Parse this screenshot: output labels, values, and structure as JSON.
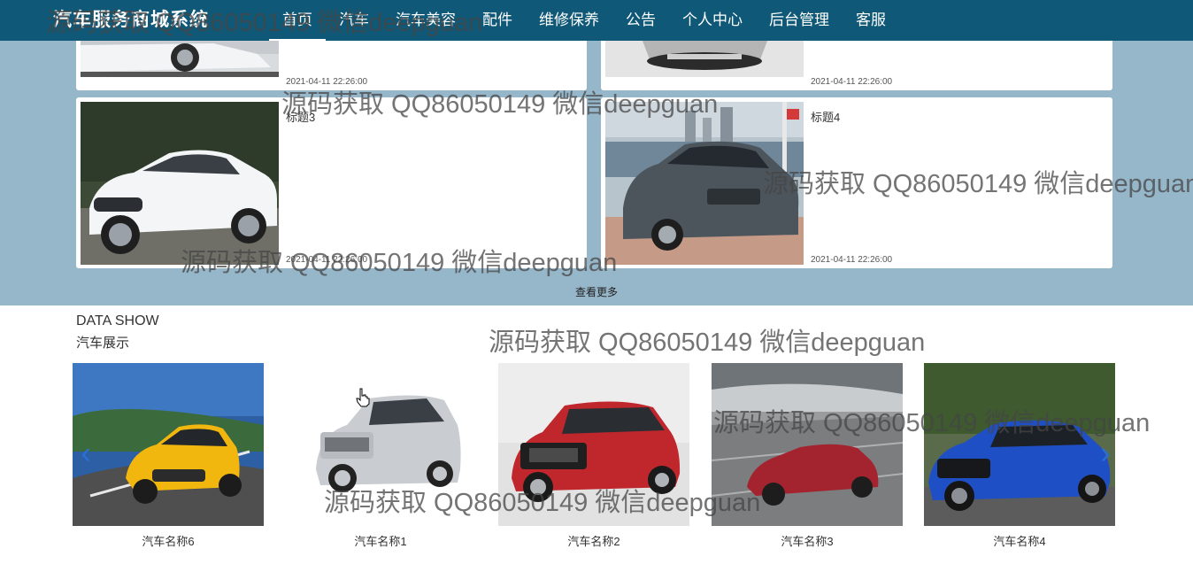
{
  "nav": {
    "brand": "汽车服务商城系统",
    "items": [
      "首页",
      "汽车",
      "汽车美容",
      "配件",
      "维修保养",
      "公告",
      "个人中心",
      "后台管理",
      "客服"
    ]
  },
  "news": {
    "items": [
      {
        "title": "",
        "date": "2021-04-11 22:26:00"
      },
      {
        "title": "",
        "date": "2021-04-11 22:26:00"
      },
      {
        "title": "标题3",
        "date": "2021-04-11 22:26:00"
      },
      {
        "title": "标题4",
        "date": "2021-04-11 22:26:00"
      }
    ],
    "more": "查看更多"
  },
  "datashow": {
    "title_en": "DATA SHOW",
    "title_cn": "汽车展示",
    "cars": [
      {
        "name": "汽车名称6"
      },
      {
        "name": "汽车名称1"
      },
      {
        "name": "汽车名称2"
      },
      {
        "name": "汽车名称3"
      },
      {
        "name": "汽车名称4"
      }
    ]
  },
  "watermark": "源码获取 QQ86050149 微信deepguan",
  "colors": {
    "nav_bg": "#0f5877",
    "news_bg": "#96b6c9",
    "arrow": "#2b6fd6"
  }
}
